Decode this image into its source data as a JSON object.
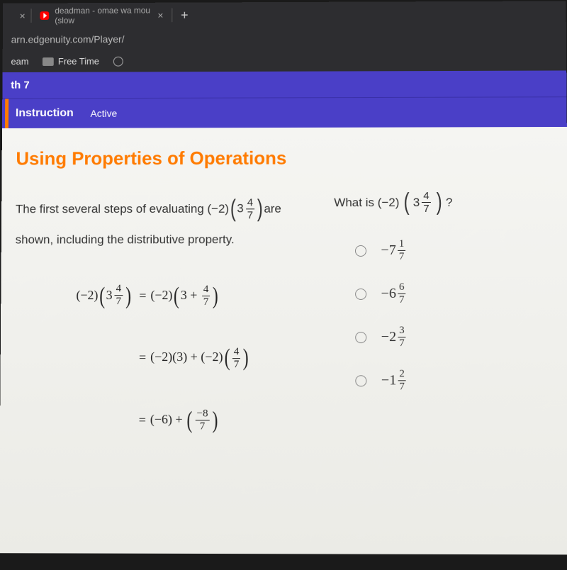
{
  "browser": {
    "tab1_close": "×",
    "tab2_title": "deadman - omae wa mou (slow",
    "tab2_close": "×",
    "new_tab": "+",
    "url": "arn.edgenuity.com/Player/",
    "bookmarks": {
      "item1": "eam",
      "item2": "Free Time"
    }
  },
  "course": {
    "title": "th 7",
    "instruction": "Instruction",
    "active": "Active"
  },
  "section": {
    "title": "Using Properties of Operations"
  },
  "prompt": {
    "line1a": "The first several steps of evaluating (−2)",
    "line1b": "are",
    "line2": "shown, including the distributive property.",
    "mixed_whole": "3",
    "mixed_num": "4",
    "mixed_den": "7"
  },
  "math": {
    "r1_left_a": "(−2)",
    "r1_left_whole": "3",
    "r1_right_a": "(−2)",
    "r1_right_b": "3 + ",
    "r2_b": "(−2)(3) + (−2)",
    "r3_a": "(−6) + ",
    "r3_num": "−8",
    "r3_den": "7",
    "frac_num": "4",
    "frac_den": "7",
    "eq": "="
  },
  "question": {
    "text_a": "What is (−2)",
    "text_b": "?",
    "mixed_whole": "3",
    "mixed_num": "4",
    "mixed_den": "7"
  },
  "options": {
    "a_int": "−7",
    "a_num": "1",
    "a_den": "7",
    "b_int": "−6",
    "b_num": "6",
    "b_den": "7",
    "c_int": "−2",
    "c_num": "3",
    "c_den": "7",
    "d_int": "−1",
    "d_num": "2",
    "d_den": "7"
  }
}
